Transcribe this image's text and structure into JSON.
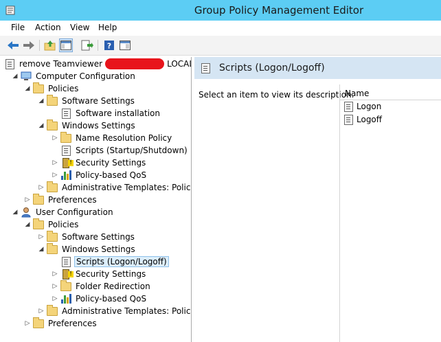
{
  "window": {
    "title": "Group Policy Management Editor"
  },
  "menu": [
    "File",
    "Action",
    "View",
    "Help"
  ],
  "toolbar": [
    "back-arrow-icon",
    "forward-arrow-icon",
    "up-folder-icon",
    "show-hide-tree-icon",
    "export-list-icon",
    "help-icon",
    "properties-pane-icon"
  ],
  "tree": [
    {
      "label": "remove Teamviewer",
      "suffix": "LOCAL]",
      "level": 0,
      "icon": "gpo-scroll-icon",
      "expander": ""
    },
    {
      "label": "Computer Configuration",
      "level": 1,
      "icon": "computer-icon",
      "expander": "open"
    },
    {
      "label": "Policies",
      "level": 2,
      "icon": "folder-icon",
      "expander": "open"
    },
    {
      "label": "Software Settings",
      "level": 3,
      "icon": "folder-icon",
      "expander": "open"
    },
    {
      "label": "Software installation",
      "level": 4,
      "icon": "script-icon",
      "expander": ""
    },
    {
      "label": "Windows Settings",
      "level": 3,
      "icon": "folder-icon",
      "expander": "open"
    },
    {
      "label": "Name Resolution Policy",
      "level": 4,
      "icon": "folder-icon",
      "expander": "closed"
    },
    {
      "label": "Scripts (Startup/Shutdown)",
      "level": 4,
      "icon": "script-icon",
      "expander": ""
    },
    {
      "label": "Security Settings",
      "level": 4,
      "icon": "security-icon",
      "expander": "closed"
    },
    {
      "label": "Policy-based QoS",
      "level": 4,
      "icon": "qos-chart-icon",
      "expander": "closed"
    },
    {
      "label": "Administrative Templates: Policy de",
      "level": 3,
      "icon": "folder-icon",
      "expander": "closed"
    },
    {
      "label": "Preferences",
      "level": 2,
      "icon": "folder-icon",
      "expander": "closed"
    },
    {
      "label": "User Configuration",
      "level": 1,
      "icon": "user-icon",
      "expander": "open"
    },
    {
      "label": "Policies",
      "level": 2,
      "icon": "folder-icon",
      "expander": "open"
    },
    {
      "label": "Software Settings",
      "level": 3,
      "icon": "folder-icon",
      "expander": "closed"
    },
    {
      "label": "Windows Settings",
      "level": 3,
      "icon": "folder-icon",
      "expander": "open"
    },
    {
      "label": "Scripts (Logon/Logoff)",
      "level": 4,
      "icon": "script-icon",
      "expander": "",
      "selected": true
    },
    {
      "label": "Security Settings",
      "level": 4,
      "icon": "security-icon",
      "expander": "closed"
    },
    {
      "label": "Folder Redirection",
      "level": 4,
      "icon": "folder-icon",
      "expander": "closed"
    },
    {
      "label": "Policy-based QoS",
      "level": 4,
      "icon": "qos-chart-icon",
      "expander": "closed"
    },
    {
      "label": "Administrative Templates: Policy def",
      "level": 3,
      "icon": "folder-icon",
      "expander": "closed"
    },
    {
      "label": "Preferences",
      "level": 2,
      "icon": "folder-icon",
      "expander": "closed"
    }
  ],
  "details": {
    "header": "Scripts (Logon/Logoff)",
    "description": "Select an item to view its description.",
    "column": "Name",
    "items": [
      "Logon",
      "Logoff"
    ]
  },
  "colors": {
    "titlebar": "#5ccdf4",
    "header": "#d5e5f3",
    "redaction": "#e8141c"
  }
}
